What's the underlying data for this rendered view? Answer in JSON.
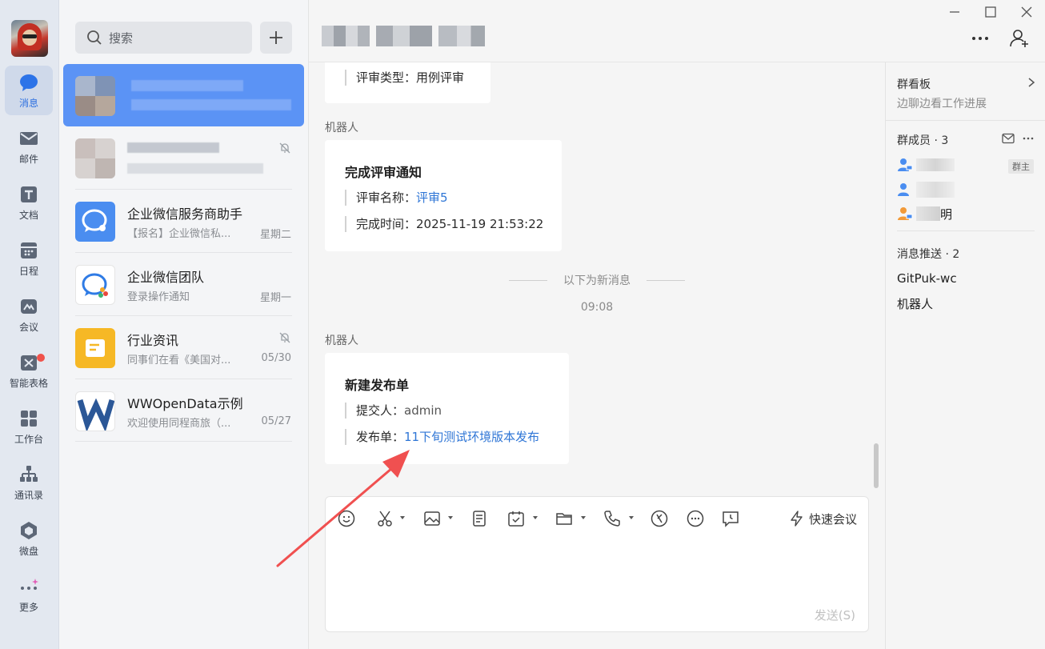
{
  "rail": {
    "items": [
      {
        "label": "消息",
        "icon": "message-icon"
      },
      {
        "label": "邮件",
        "icon": "mail-icon"
      },
      {
        "label": "文档",
        "icon": "doc-icon"
      },
      {
        "label": "日程",
        "icon": "calendar-icon"
      },
      {
        "label": "会议",
        "icon": "meeting-icon"
      },
      {
        "label": "智能表格",
        "icon": "smart-sheet-icon"
      },
      {
        "label": "工作台",
        "icon": "workbench-icon"
      },
      {
        "label": "通讯录",
        "icon": "contacts-icon"
      },
      {
        "label": "微盘",
        "icon": "drive-icon"
      },
      {
        "label": "更多",
        "icon": "more-icon"
      }
    ]
  },
  "search": {
    "placeholder": "搜索"
  },
  "conversations": [
    {
      "name": "",
      "preview": "",
      "time": ""
    },
    {
      "name": "",
      "preview": "",
      "time": ""
    },
    {
      "name": "企业微信服务商助手",
      "preview": "【报名】企业微信私...",
      "time": "星期二"
    },
    {
      "name": "企业微信团队",
      "preview": "登录操作通知",
      "time": "星期一"
    },
    {
      "name": "行业资讯",
      "preview": "同事们在看《美国对...",
      "time": "05/30"
    },
    {
      "name": "WWOpenData示例",
      "preview": "欢迎使用同程商旅（...",
      "time": "05/27"
    }
  ],
  "messages": {
    "card1": {
      "row1_key": "评审类型：",
      "row1_val": "用例评审"
    },
    "card2": {
      "sender": "机器人",
      "title": "完成评审通知",
      "row1_key": "评审名称：",
      "row1_val": "评审5",
      "row2_key": "完成时间：",
      "row2_val": "2025-11-19 21:53:22"
    },
    "divider": "以下为新消息",
    "timestamp": "09:08",
    "card3": {
      "sender": "机器人",
      "title": "新建发布单",
      "row1_key": "提交人：",
      "row1_val": "admin",
      "row2_key": "发布单：",
      "row2_val": "11下旬测试环境版本发布"
    }
  },
  "composer": {
    "quick_meeting": "快速会议",
    "send": "发送(S)"
  },
  "right_panel": {
    "board_title": "群看板",
    "board_sub": "边聊边看工作进展",
    "members_title": "群成员 · 3",
    "owner_badge": "群主",
    "member3_suffix": "明",
    "push_title": "消息推送 · 2",
    "push_items": [
      "GitPuk-wc",
      "机器人"
    ]
  },
  "colors": {
    "accent": "#2f76d6",
    "active_conv": "#5b93f5",
    "arrow": "#f05050"
  }
}
